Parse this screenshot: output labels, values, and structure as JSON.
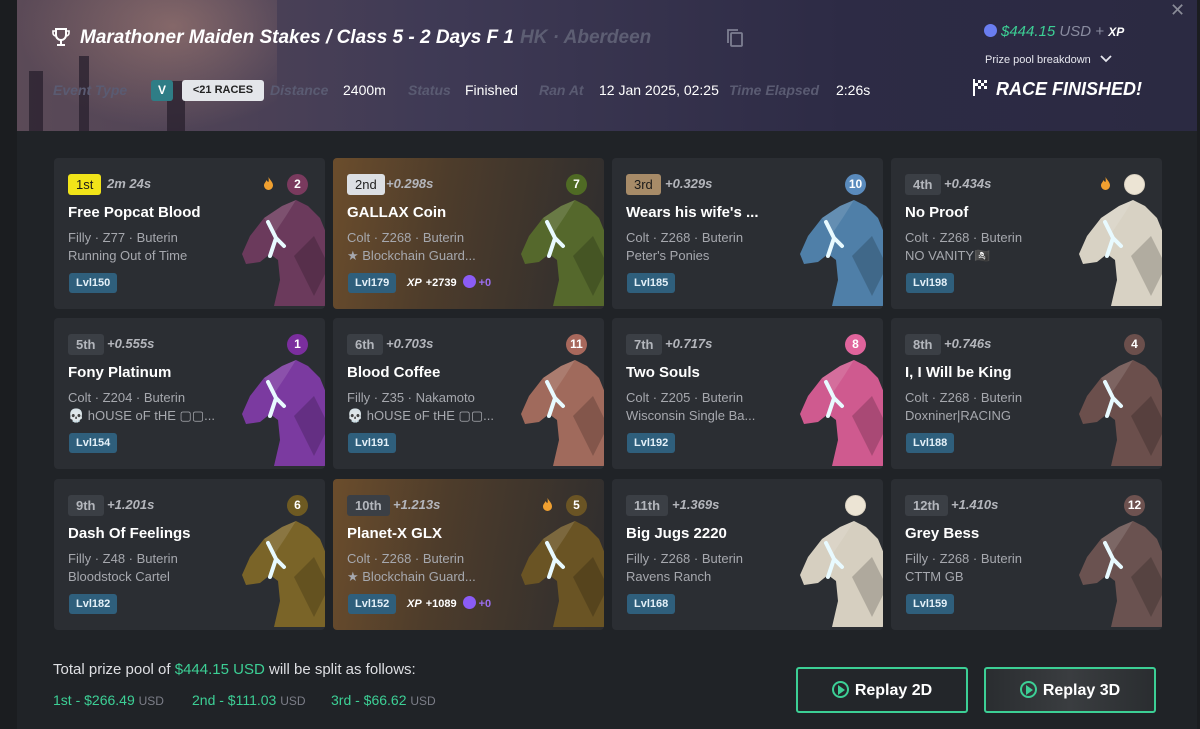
{
  "header": {
    "title": "Marathoner Maiden Stakes / Class 5 - 2 Days F 1",
    "venue": "HK · Aberdeen",
    "event_type_label": "Event Type",
    "event_type_badge": "V",
    "races_badge": "<21 RACES",
    "distance_label": "Distance",
    "distance_value": "2400m",
    "status_label": "Status",
    "status_value": "Finished",
    "ran_at_label": "Ran At",
    "ran_at_value": "12 Jan 2025, 02:25",
    "time_elapsed_label": "Time Elapsed",
    "time_elapsed_value": "2:26s",
    "prize_amount": "$444.15",
    "prize_currency": "USD",
    "prize_plus": "+",
    "prize_xp": "XP",
    "breakdown_label": "Prize pool breakdown",
    "race_finished": "RACE FINISHED!"
  },
  "cards": [
    {
      "pos": "1st",
      "gap": "2m 24s",
      "number": "2",
      "name": "Free Popcat Blood",
      "info": "Filly · Z77 · Buterin",
      "owner": "Running Out of Time",
      "level": "Lvl150",
      "fire": true,
      "xp": null,
      "horse_color": "#6b3a5c",
      "num_color": "#7a3a5e"
    },
    {
      "pos": "2nd",
      "gap": "+0.298s",
      "number": "7",
      "name": "GALLAX Coin",
      "info": "Colt · Z268 · Buterin",
      "owner": "★ Blockchain Guard...",
      "level": "Lvl179",
      "fire": false,
      "xp": {
        "label": "XP",
        "value": "+2739",
        "plus": "+0"
      },
      "horse_color": "#55682c",
      "num_color": "#4f6a24"
    },
    {
      "pos": "3rd",
      "gap": "+0.329s",
      "number": "10",
      "name": "Wears his wife's ...",
      "info": "Colt · Z268 · Buterin",
      "owner": "Peter's Ponies",
      "level": "Lvl185",
      "fire": false,
      "xp": null,
      "horse_color": "#4f7fa8",
      "num_color": "#5a8bbd"
    },
    {
      "pos": "4th",
      "gap": "+0.434s",
      "number": "",
      "name": "No Proof",
      "info": "Colt · Z268 · Buterin",
      "owner": "NO VANITY🏴‍☠️",
      "level": "Lvl198",
      "fire": true,
      "xp": null,
      "horse_color": "#d8d2c4",
      "num_color": "#ece4d4"
    },
    {
      "pos": "5th",
      "gap": "+0.555s",
      "number": "1",
      "name": "Fony Platinum",
      "info": "Colt · Z204 · Buterin",
      "owner": "💀 hOUSE oF tHE ▢▢...",
      "level": "Lvl154",
      "fire": false,
      "xp": null,
      "horse_color": "#7b3aa0",
      "num_color": "#7b2e9e"
    },
    {
      "pos": "6th",
      "gap": "+0.703s",
      "number": "11",
      "name": "Blood Coffee",
      "info": "Filly · Z35 · Nakamoto",
      "owner": "💀 hOUSE oF tHE ▢▢...",
      "level": "Lvl191",
      "fire": false,
      "xp": null,
      "horse_color": "#a06a5c",
      "num_color": "#a8685c"
    },
    {
      "pos": "7th",
      "gap": "+0.717s",
      "number": "8",
      "name": "Two Souls",
      "info": "Colt · Z205 · Buterin",
      "owner": "Wisconsin Single Ba...",
      "level": "Lvl192",
      "fire": false,
      "xp": null,
      "horse_color": "#cf5a8f",
      "num_color": "#e0649c"
    },
    {
      "pos": "8th",
      "gap": "+0.746s",
      "number": "4",
      "name": "I, I Will be King",
      "info": "Colt · Z268 · Buterin",
      "owner": "Doxniner|RACING",
      "level": "Lvl188",
      "fire": false,
      "xp": null,
      "horse_color": "#6b4f4c",
      "num_color": "#6b4f4c"
    },
    {
      "pos": "9th",
      "gap": "+1.201s",
      "number": "6",
      "name": "Dash Of Feelings",
      "info": "Filly · Z48 · Buterin",
      "owner": "Bloodstock Cartel",
      "level": "Lvl182",
      "fire": false,
      "xp": null,
      "horse_color": "#7a6428",
      "num_color": "#6e5a22"
    },
    {
      "pos": "10th",
      "gap": "+1.213s",
      "number": "5",
      "name": "Planet-X GLX",
      "info": "Colt · Z268 · Buterin",
      "owner": "★ Blockchain Guard...",
      "level": "Lvl152",
      "fire": true,
      "xp": {
        "label": "XP",
        "value": "+1089",
        "plus": "+0"
      },
      "horse_color": "#6a5424",
      "num_color": "#6a5424"
    },
    {
      "pos": "11th",
      "gap": "+1.369s",
      "number": "",
      "name": "Big Jugs 2220",
      "info": "Filly · Z268 · Buterin",
      "owner": "Ravens Ranch",
      "level": "Lvl168",
      "fire": false,
      "xp": null,
      "horse_color": "#d6cfc0",
      "num_color": "#ece4d4"
    },
    {
      "pos": "12th",
      "gap": "+1.410s",
      "number": "12",
      "name": "Grey Bess",
      "info": "Filly · Z268 · Buterin",
      "owner": "CTTM GB",
      "level": "Lvl159",
      "fire": false,
      "xp": null,
      "horse_color": "#6a5250",
      "num_color": "#6e5250"
    }
  ],
  "footer": {
    "pool_prefix": "Total prize pool of",
    "pool_amount": "$444.15 USD",
    "pool_suffix": "will be split as follows:",
    "splits": [
      {
        "label": "1st - $266.49",
        "unit": "USD"
      },
      {
        "label": "2nd - $111.03",
        "unit": "USD"
      },
      {
        "label": "3rd - $66.62",
        "unit": "USD"
      }
    ],
    "replay_2d": "Replay 2D",
    "replay_3d": "Replay 3D"
  },
  "colors": {
    "accent": "#3ccf95",
    "first": "#f1e419",
    "second": "#dcdfe3",
    "third": "#a78b68",
    "level_badge": "#2f5f7c"
  }
}
